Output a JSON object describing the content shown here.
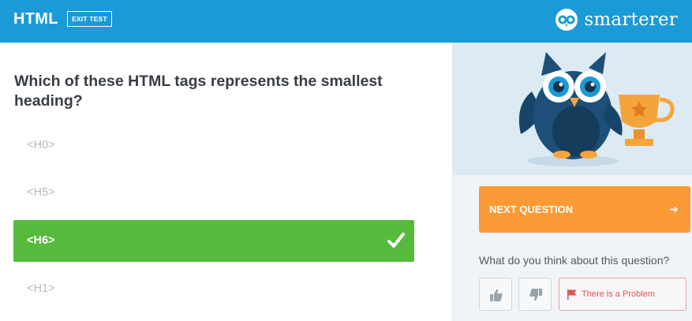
{
  "header": {
    "test_name": "HTML",
    "exit_label": "EXIT TEST",
    "brand": "smarterer"
  },
  "question": {
    "text": "Which of these HTML tags represents the smallest heading?"
  },
  "answers": [
    {
      "label": "<H0>",
      "selected": false
    },
    {
      "label": "<H5>",
      "selected": false
    },
    {
      "label": "<H6>",
      "selected": true
    },
    {
      "label": "<H1>",
      "selected": false
    }
  ],
  "sidebar": {
    "next_label": "NEXT QUESTION",
    "next_icon": "arrow-right-icon",
    "feedback_prompt": "What do you think about this question?",
    "thumbs_up_icon": "thumbs-up-icon",
    "thumbs_down_icon": "thumbs-down-icon",
    "problem_label": "There is a Problem",
    "problem_icon": "flag-icon"
  },
  "colors": {
    "header": "#1a9ad6",
    "selected_answer": "#56ba3c",
    "next_button": "#fb9a34",
    "problem": "#e0564f"
  }
}
